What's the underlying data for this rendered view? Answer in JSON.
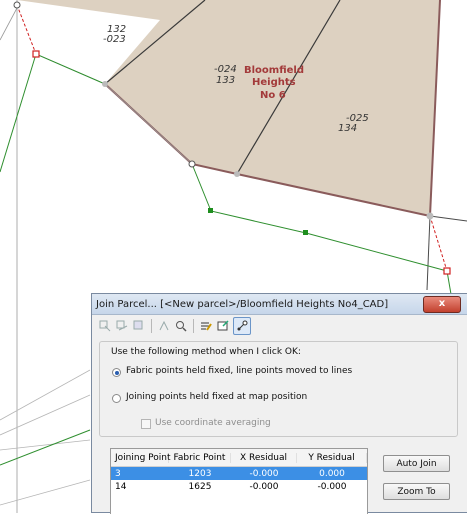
{
  "map": {
    "parcels": [
      {
        "id": "132",
        "line": "-023"
      },
      {
        "id": "133",
        "line": "-024"
      },
      {
        "id": "134",
        "line": "-025"
      }
    ],
    "name_label": [
      "Bloomfield",
      "Heights",
      "No 6"
    ]
  },
  "dialog": {
    "title": "Join Parcel... [<New parcel>/Bloomfield Heights No4_CAD]",
    "close_label": "x",
    "method_prompt": "Use the following method when I click OK:",
    "option_fabric": "Fabric points held fixed, line points moved to lines",
    "option_joining": "Joining points held fixed at map position",
    "option_averaging": "Use coordinate averaging",
    "table": {
      "columns": [
        "Joining Point",
        "Fabric Point",
        "X Residual",
        "Y Residual"
      ],
      "rows": [
        [
          "3",
          "1203",
          "-0.000",
          "0.000"
        ],
        [
          "14",
          "1625",
          "-0.000",
          "-0.000"
        ]
      ]
    },
    "auto_join_label": "Auto Join",
    "zoom_to_label": "Zoom To"
  }
}
